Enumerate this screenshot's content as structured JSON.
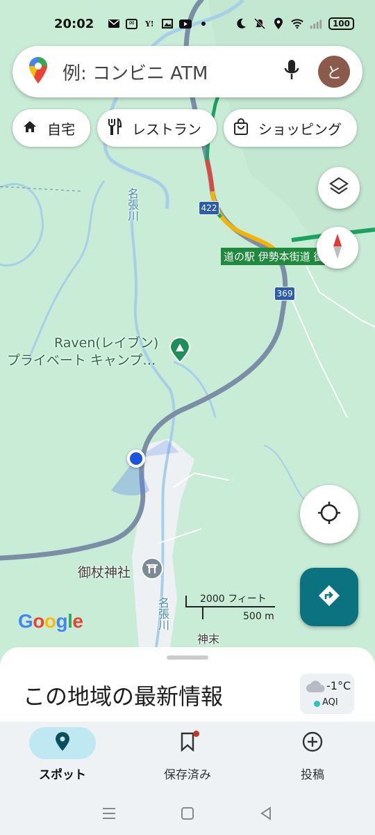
{
  "status_bar": {
    "time": "20:02",
    "battery": "100",
    "left_icons": [
      "mail-icon",
      "chat-icon",
      "yahoo-icon",
      "image-icon",
      "youtube-icon",
      "dot-icon"
    ],
    "right_icons": [
      "moon-icon",
      "silent-icon",
      "location-icon",
      "wifi-icon",
      "signal-icon"
    ],
    "yahoo_glyph": "Y!"
  },
  "search": {
    "placeholder": "例: コンビニ ATM",
    "avatar_letter": "と"
  },
  "chips": [
    {
      "label": "自宅",
      "icon": "home-icon"
    },
    {
      "label": "レストラン",
      "icon": "restaurant-icon"
    },
    {
      "label": "ショッピング",
      "icon": "shopping-bag-icon"
    }
  ],
  "map": {
    "route_422": "422",
    "route_369": "369",
    "highway_label": "道の駅 伊勢本街道 御杖",
    "river_label_top": "名張川",
    "river_label_bottom": "名張川",
    "camp_name_line1": "Raven(レイブン)",
    "camp_name_line2": "プライベート キャンプ…",
    "shrine_label": "御杖神社",
    "town_label": "神末",
    "scale_imperial": "2000 フィート",
    "scale_metric": "500 m",
    "google_logo": "Google",
    "colors": {
      "land": "#c9ecd6",
      "water": "#a7cfe8",
      "road": "#7a8ea6",
      "town": "#eef1f3",
      "location_dot": "#1a56db"
    }
  },
  "sheet": {
    "title": "この地域の最新情報",
    "temperature": "-1°C",
    "aqi_label": "AQI"
  },
  "bottom_nav": [
    {
      "label": "スポット",
      "icon": "explore-pin-icon",
      "active": true
    },
    {
      "label": "保存済み",
      "icon": "bookmark-icon",
      "active": false
    },
    {
      "label": "投稿",
      "icon": "add-circle-icon",
      "active": false
    }
  ]
}
